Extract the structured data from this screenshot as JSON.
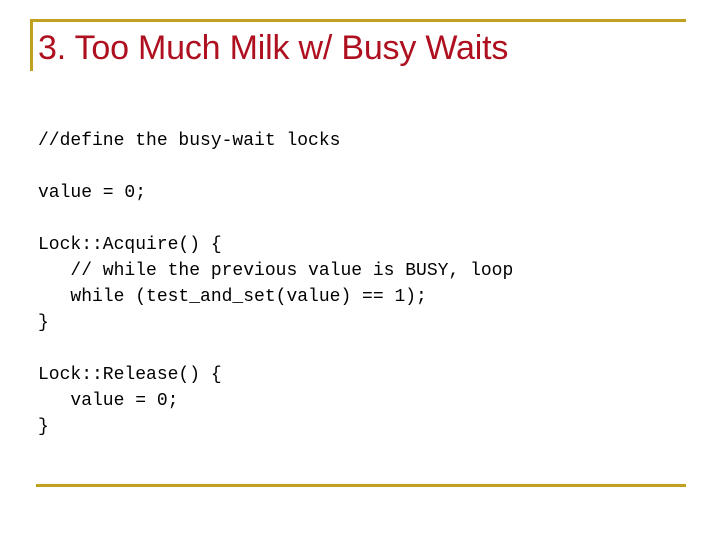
{
  "slide": {
    "title": "3. Too Much Milk w/ Busy Waits",
    "title_color": "#af1020",
    "rule_color": "#bfa01f",
    "background_color": "#ffffff",
    "code_color": "#000000",
    "code_lines": [
      "//define the busy-wait locks",
      "",
      "value = 0;",
      "",
      "Lock::Acquire() {",
      "   // while the previous value is BUSY, loop",
      "   while (test_and_set(value) == 1);",
      "}",
      "",
      "Lock::Release() {",
      "   value = 0;",
      "}"
    ]
  }
}
